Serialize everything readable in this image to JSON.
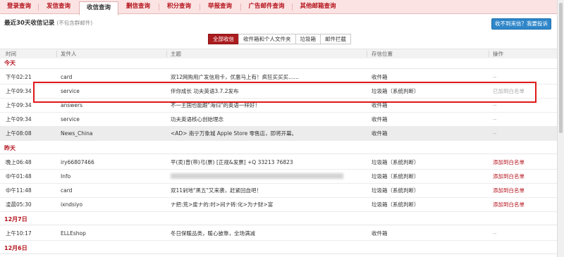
{
  "tabs": [
    {
      "label": "登录查询",
      "active": false
    },
    {
      "label": "发信查询",
      "active": false
    },
    {
      "label": "收信查询",
      "active": true
    },
    {
      "label": "删信查询",
      "active": false
    },
    {
      "label": "积分查询",
      "active": false
    },
    {
      "label": "举报查询",
      "active": false
    },
    {
      "label": "广告邮件查询",
      "active": false
    },
    {
      "label": "其他邮箱查询",
      "active": false
    }
  ],
  "header": {
    "title": "最近30天收信记录",
    "note": "(不包含群邮件)",
    "cta": "收不到来信？我要投诉"
  },
  "filters": [
    {
      "label": "全部收信",
      "active": true
    },
    {
      "label": "收件箱和个人文件夹",
      "active": false
    },
    {
      "label": "垃圾箱",
      "active": false
    },
    {
      "label": "邮件拦截",
      "active": false
    }
  ],
  "columns": {
    "time": "时间",
    "sender": "发件人",
    "subject": "主题",
    "location": "存信位置",
    "action": "操作"
  },
  "groups": [
    {
      "label": "今天",
      "rows": [
        {
          "time": "下午02:21",
          "sender": "card",
          "subject": "双12网购用广发信用卡，优惠马上有！疯狂买买买……",
          "location": "收件箱",
          "action": "--"
        },
        {
          "time": "上午09:34",
          "sender": "service",
          "subject": "伴你成长 功夫英语3.7.2发布",
          "location": "垃圾箱（系统判断）",
          "action": "已加到白名单"
        },
        {
          "time": "上午09:34",
          "sender": "answers",
          "subject": "不一主国也能跟\"海归\"的英语一样好！",
          "location": "收件箱",
          "action": "--"
        },
        {
          "time": "上午09:34",
          "sender": "service",
          "subject": "功夫英语核心创始理念",
          "location": "收件箱",
          "action": "--"
        },
        {
          "time": "上午08:08",
          "sender": "News_China",
          "subject": "<AD> 南宁万象城 Apple Store 零售店，即将开幕。",
          "location": "收件箱",
          "action": "--"
        }
      ]
    },
    {
      "label": "昨天",
      "rows": [
        {
          "time": "晚上06:48",
          "sender": "iry66807466",
          "subject": "平(卖)曾(带)弓(票) [正规&发票] +Q 33213 76823",
          "location": "垃圾箱（系统判断）",
          "action": "添加到白名单"
        },
        {
          "time": "中午01:48",
          "sender": "Info",
          "subject": "",
          "location": "垃圾箱（系统判断）",
          "action": "添加到白名单"
        },
        {
          "time": "中午11:48",
          "sender": "card",
          "subject": "双11剁地\"黑五\"又来袭，赶紧回血吧！",
          "location": "垃圾箱（系统判断）",
          "action": "添加到白名单"
        },
        {
          "time": "凌晨05:30",
          "sender": "ixndsiyo",
          "subject": "ナ把:荒>废ナ的:时>间ナ砖:化>为ナ财>富",
          "location": "垃圾箱（系统判断）",
          "action": "添加到白名单"
        }
      ]
    },
    {
      "label": "12月7日",
      "rows": [
        {
          "time": "上午10:17",
          "sender": "ELLEshop",
          "subject": "冬日保暖品类，暖心披靠，全场满减",
          "location": "收件箱",
          "action": "--"
        }
      ]
    },
    {
      "label": "12月6日",
      "rows": []
    }
  ],
  "colors": {
    "brand": "#b4111a",
    "tab_bg": "#fbe3e3",
    "cta": "#2f86c9",
    "highlight": "#e01818",
    "filter_active": "#ab1c1f"
  }
}
